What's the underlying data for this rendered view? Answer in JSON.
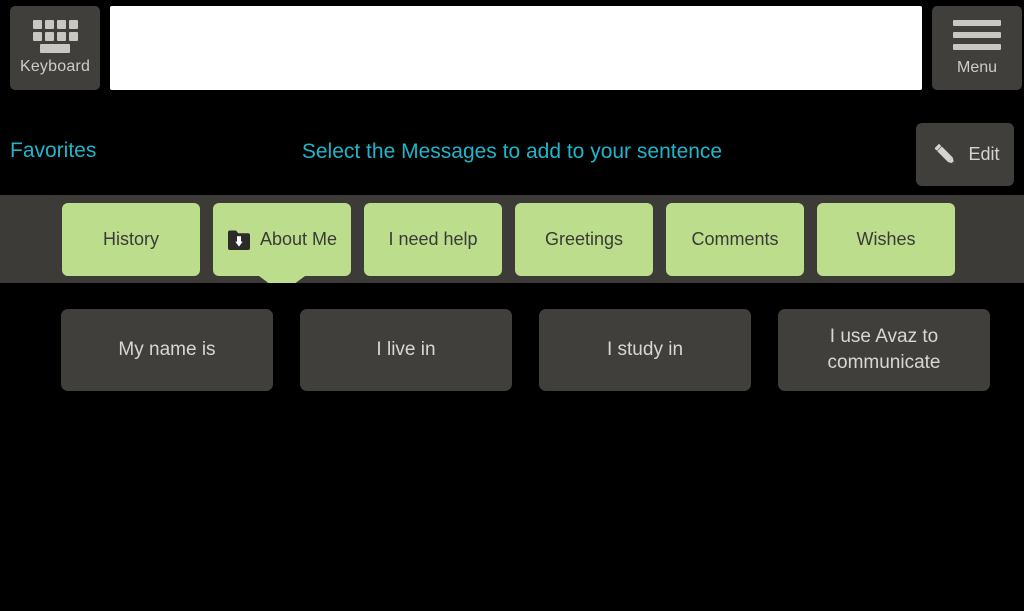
{
  "app": {
    "name": "Avaz",
    "accent_cyan": "#1fb6c9",
    "tab_green": "#bcdd8c",
    "panel_gray": "#413f3c",
    "strip_gray": "#3d3b37",
    "background": "#000000"
  },
  "topbar": {
    "keyboard_button": {
      "label": "Keyboard",
      "icon": "keyboard-icon"
    },
    "sentence_field": {
      "value": "",
      "placeholder": ""
    },
    "menu_button": {
      "label": "Menu",
      "icon": "hamburger-menu-icon"
    }
  },
  "header": {
    "favorites_label": "Favorites",
    "instruction": "Select the Messages to add to your sentence",
    "edit_button": {
      "label": "Edit",
      "icon": "pencil-icon"
    }
  },
  "tabs": {
    "active_index": 1,
    "items": [
      {
        "label": "History",
        "icon": null,
        "active": false
      },
      {
        "label": "About Me",
        "icon": "folder-download-icon",
        "active": true
      },
      {
        "label": "I need help",
        "icon": null,
        "active": false
      },
      {
        "label": "Greetings",
        "icon": null,
        "active": false
      },
      {
        "label": "Comments",
        "icon": null,
        "active": false
      },
      {
        "label": "Wishes",
        "icon": null,
        "active": false
      }
    ]
  },
  "messages": {
    "items": [
      {
        "label": "My name is"
      },
      {
        "label": "I live in"
      },
      {
        "label": "I study in"
      },
      {
        "label": "I use Avaz to communicate"
      }
    ]
  }
}
